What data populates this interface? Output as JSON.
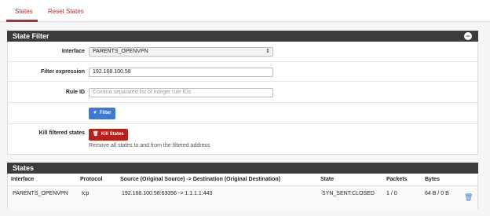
{
  "tabs": [
    {
      "label": "States"
    },
    {
      "label": "Reset States"
    }
  ],
  "state_filter": {
    "title": "State Filter",
    "interface_label": "Interface",
    "interface_value": "PARENTS_OPENVPN",
    "filter_expression_label": "Filter expression",
    "filter_expression_value": "192.168.100.58",
    "rule_id_label": "Rule ID",
    "rule_id_placeholder": "Comma separated list of integer rule IDs",
    "filter_button": "Filter",
    "kill_label": "Kill filtered states",
    "kill_button": "Kill States",
    "kill_help": "Remove all states to and from the filtered address"
  },
  "states": {
    "title": "States",
    "columns": [
      "Interface",
      "Protocol",
      "Source (Original Source) -> Destination (Original Destination)",
      "State",
      "Packets",
      "Bytes"
    ],
    "rows": [
      {
        "interface": "PARENTS_OPENVPN",
        "protocol": "tcp",
        "source_dest": "192.168.100.58:63356 -> 1.1.1.1:443",
        "state": "SYN_SENT:CLOSED",
        "packets": "1 / 0",
        "bytes": "64 B / 0 B"
      }
    ]
  },
  "colors": {
    "accent": "#a83232",
    "panel_header": "#3c3c3c",
    "primary_button": "#3a7bd5",
    "danger_button": "#b6211c"
  }
}
